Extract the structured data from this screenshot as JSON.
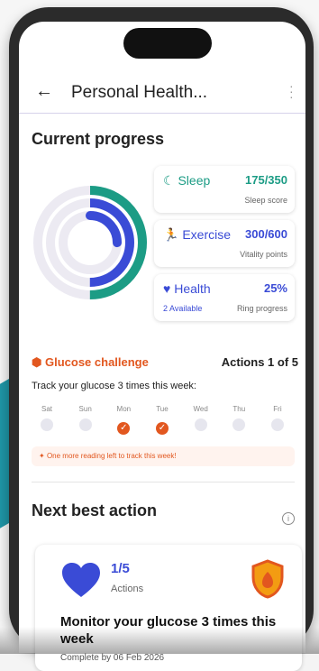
{
  "header": {
    "title": "Personal Health..."
  },
  "progress": {
    "section_title": "Current progress",
    "sleep": {
      "label": "Sleep",
      "value": "175/350",
      "sub": "Sleep score",
      "fraction": 0.5
    },
    "exercise": {
      "label": "Exercise",
      "value": "300/600",
      "sub": "Vitality points",
      "fraction": 0.5
    },
    "health": {
      "label": "Health",
      "value": "25%",
      "sub": "Ring progress",
      "available": "2 Available",
      "fraction": 0.25
    }
  },
  "challenge": {
    "title": "Glucose challenge",
    "actions": "Actions 1 of 5",
    "track": "Track your glucose 3 times this week:",
    "days": [
      {
        "label": "Sat",
        "done": false
      },
      {
        "label": "Sun",
        "done": false
      },
      {
        "label": "Mon",
        "done": true
      },
      {
        "label": "Tue",
        "done": true
      },
      {
        "label": "Wed",
        "done": false
      },
      {
        "label": "Thu",
        "done": false
      },
      {
        "label": "Fri",
        "done": false
      }
    ],
    "reminder": "One more reading left to track this week!"
  },
  "next": {
    "section_title": "Next best action",
    "count": "1/5",
    "count_sub": "Actions",
    "title": "Monitor your glucose 3 times this week",
    "due": "Complete by 06 Feb 2026"
  },
  "colors": {
    "sleep": "#1c9c85",
    "exercise": "#3a4bd6",
    "health": "#3a4bd6",
    "accent": "#e2571f"
  }
}
